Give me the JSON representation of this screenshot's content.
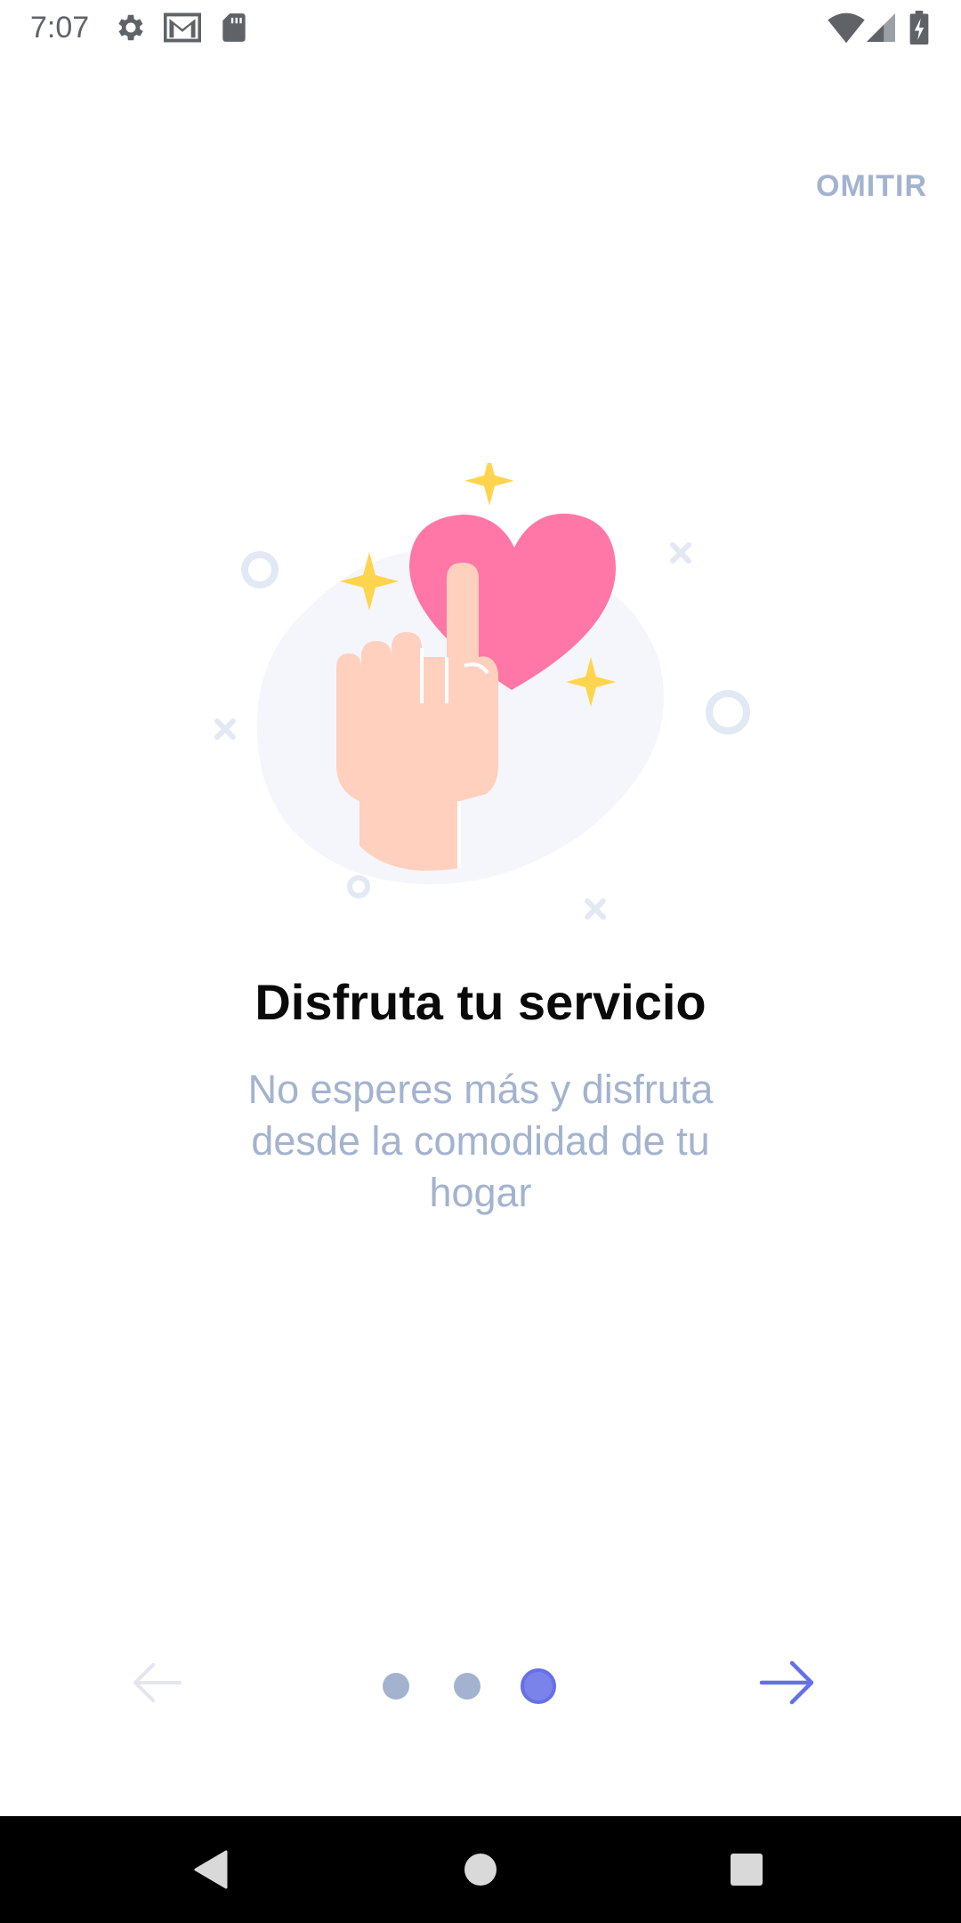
{
  "status_bar": {
    "time": "7:07",
    "icons": [
      "gear-icon",
      "gmail-icon",
      "sd-card-icon",
      "wifi-icon",
      "signal-icon",
      "battery-icon"
    ]
  },
  "onboarding": {
    "skip_label": "OMITIR",
    "title": "Disfruta tu servicio",
    "subtitle": "No esperes más y disfruta desde la comodidad de tu hogar",
    "illustration": "hand-touching-heart-illustration",
    "page_indicator": {
      "total": 3,
      "current": 3
    },
    "colors": {
      "accent": "#6570e6",
      "muted": "#a3b3cf",
      "heart": "#ff77a6",
      "hand": "#ffd0bd",
      "sparkle": "#ffd54f"
    }
  },
  "navigation": {
    "back_icon": "arrow-left-icon",
    "next_icon": "arrow-right-icon"
  },
  "system_nav": {
    "buttons": [
      "back-triangle-icon",
      "home-circle-icon",
      "recents-square-icon"
    ]
  }
}
